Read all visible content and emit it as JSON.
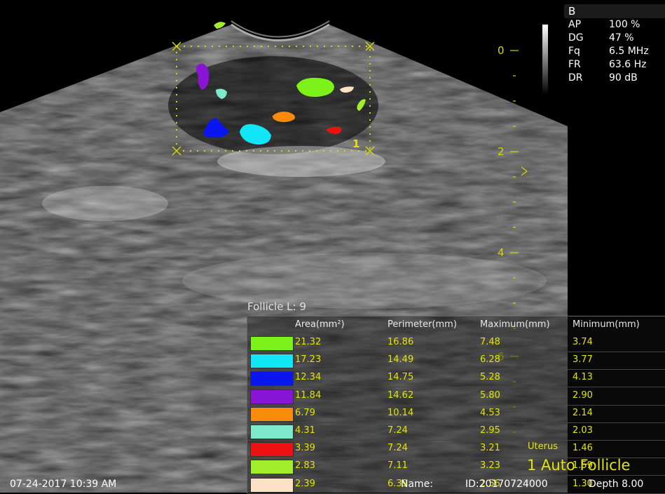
{
  "parameters": {
    "mode": "B",
    "rows": [
      {
        "key": "AP",
        "value": "100 %"
      },
      {
        "key": "DG",
        "value": "47 %"
      },
      {
        "key": "Fq",
        "value": "6.5 MHz"
      },
      {
        "key": "FR",
        "value": "63.6 Hz"
      },
      {
        "key": "DR",
        "value": "90 dB"
      }
    ]
  },
  "depth_scale": {
    "ticks": [
      "0",
      "2",
      "4",
      "6"
    ],
    "color": "#d6d600"
  },
  "roi_marker": "1",
  "follicle_table": {
    "title": "Follicle L: 9",
    "headers": [
      "Area(mm²)",
      "Perimeter(mm)",
      "Maximum(mm)",
      "Minimum(mm)"
    ],
    "rows": [
      {
        "color": "#7cf21a",
        "area": "21.32",
        "perimeter": "16.86",
        "maximum": "7.48",
        "minimum": "3.74"
      },
      {
        "color": "#11e6f6",
        "area": "17.23",
        "perimeter": "14.49",
        "maximum": "6.28",
        "minimum": "3.77"
      },
      {
        "color": "#0a16f0",
        "area": "12.34",
        "perimeter": "14.75",
        "maximum": "5.28",
        "minimum": "4.13"
      },
      {
        "color": "#8a14d4",
        "area": "11.84",
        "perimeter": "14.62",
        "maximum": "5.80",
        "minimum": "2.90"
      },
      {
        "color": "#f88a0c",
        "area": "6.79",
        "perimeter": "10.14",
        "maximum": "4.53",
        "minimum": "2.14"
      },
      {
        "color": "#7fe9cc",
        "area": "4.31",
        "perimeter": "7.24",
        "maximum": "2.95",
        "minimum": "2.03"
      },
      {
        "color": "#ee1111",
        "area": "3.39",
        "perimeter": "7.24",
        "maximum": "3.21",
        "minimum": "1.46"
      },
      {
        "color": "#a2ee2a",
        "area": "2.83",
        "perimeter": "7.11",
        "maximum": "3.23",
        "minimum": "1.59"
      },
      {
        "color": "#fbe2c6",
        "area": "2.39",
        "perimeter": "6.39",
        "maximum": "2.56",
        "minimum": "1.30"
      }
    ]
  },
  "status": {
    "organ": "Uterus",
    "mode_label": "1 Auto Follicle",
    "timestamp": "07-24-2017 10:39 AM",
    "name_label": "Name:",
    "id_label": "ID:20170724000",
    "depth": "Depth 8.00"
  }
}
